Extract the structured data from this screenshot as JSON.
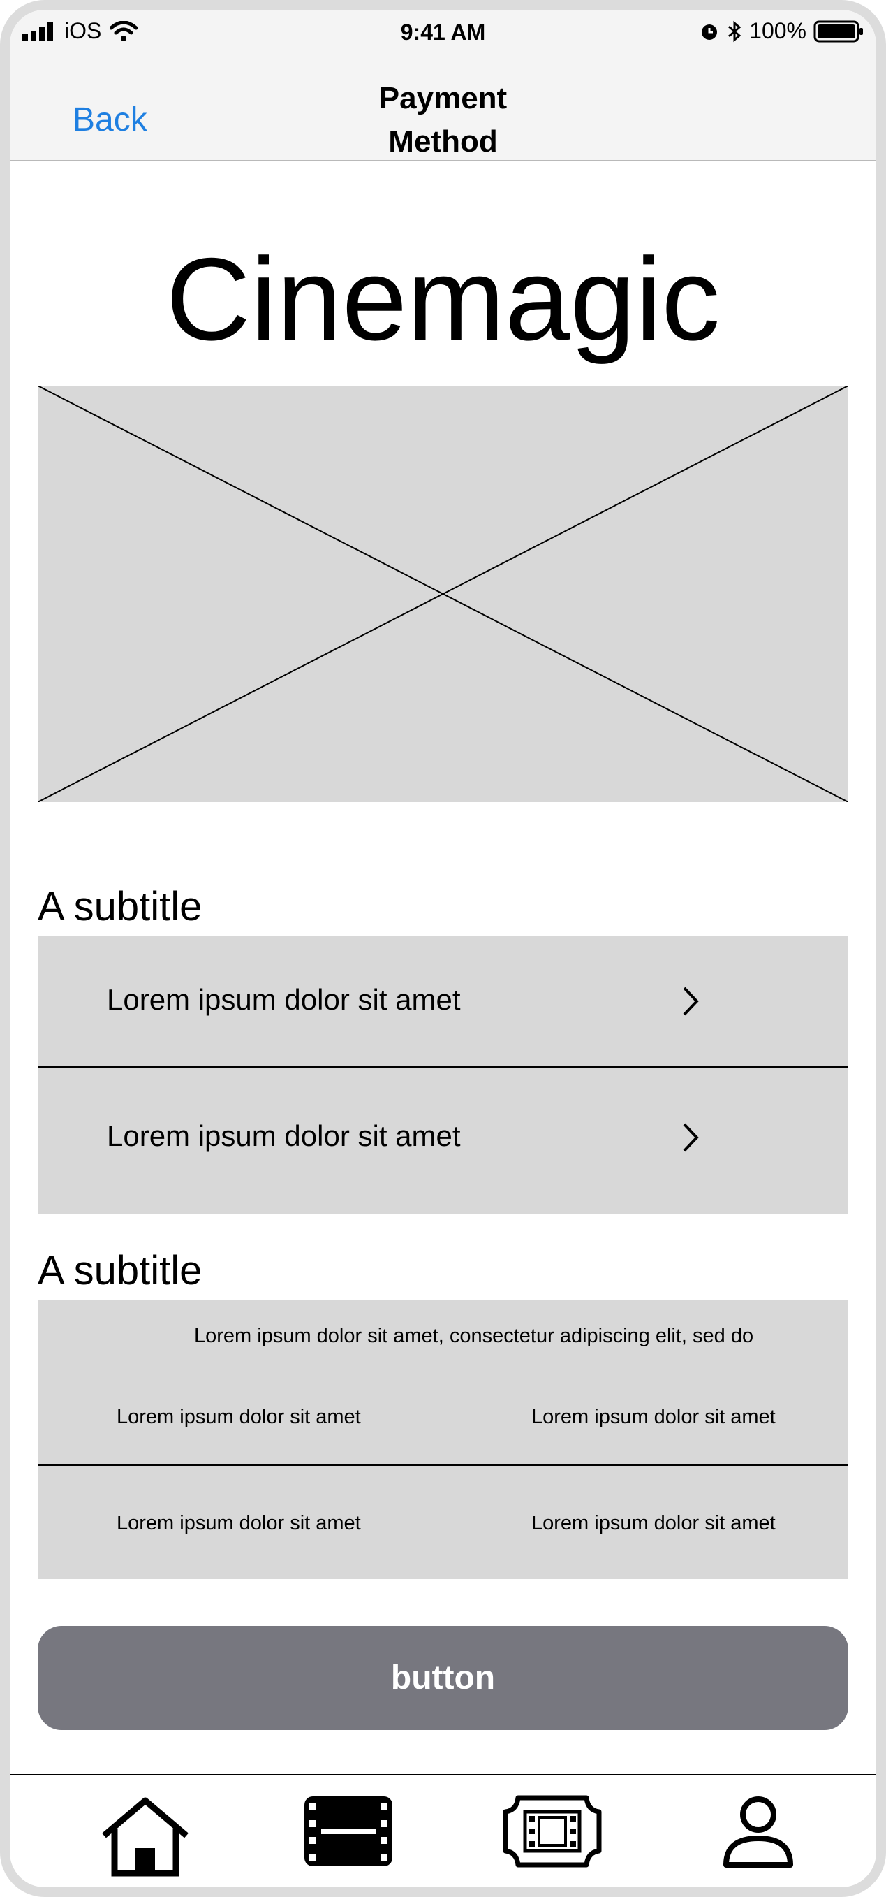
{
  "status_bar": {
    "carrier": "iOS",
    "time": "9:41 AM",
    "battery": "100%"
  },
  "nav": {
    "back_label": "Back",
    "title_line1": "Payment",
    "title_line2": "Method"
  },
  "brand": "Cinemagic",
  "section1": {
    "subtitle": "A subtitle",
    "items": [
      {
        "label": "Lorem ipsum dolor sit amet"
      },
      {
        "label": "Lorem ipsum dolor sit amet"
      }
    ]
  },
  "section2": {
    "subtitle": "A subtitle",
    "header": "Lorem ipsum dolor sit amet, consectetur adipiscing elit, sed do",
    "rows": [
      {
        "left": "Lorem ipsum dolor sit amet",
        "right": "Lorem ipsum dolor sit amet"
      },
      {
        "left": "Lorem ipsum dolor sit amet",
        "right": "Lorem ipsum dolor sit amet"
      }
    ]
  },
  "button_label": "button",
  "tabbar": {
    "icons": [
      "home-icon",
      "film-strip-icon",
      "ticket-icon",
      "profile-icon"
    ]
  },
  "colors": {
    "accent": "#1e7fe1",
    "button": "#77777f",
    "placeholder": "#d8d8d8"
  }
}
